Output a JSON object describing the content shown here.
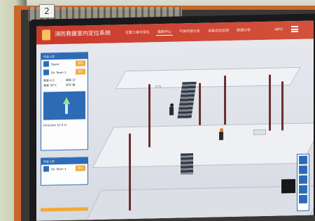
{
  "photo": {
    "placard_number": "2"
  },
  "app": {
    "title": "消防救援室内定位系统",
    "nav": [
      {
        "label": "位置三维可视化",
        "active": false
      },
      {
        "label": "指挥中心",
        "active": true
      },
      {
        "label": "气体传感分析",
        "active": false
      },
      {
        "label": "设备状态监测",
        "active": false
      },
      {
        "label": "数据分析",
        "active": false
      }
    ],
    "user": "INFO",
    "accent_color": "#c93a2c",
    "panel_color": "#2d6bb6"
  },
  "left_panel": {
    "card1": {
      "header": "作业人员",
      "rows": [
        {
          "name": "Spare",
          "sub": "信息",
          "button": "定位"
        },
        {
          "name": "Dir Team 1",
          "sub": "已登记",
          "button": "定位"
        }
      ],
      "stats": [
        "高度  4.5",
        "楼层  1F",
        "温度  30°C",
        "信号  强"
      ],
      "footer": "Direction 12.0 m"
    },
    "card2": {
      "header": "作业人员",
      "rows": [
        {
          "name": "Dir Team 2",
          "sub": "已登记",
          "button": "定位"
        }
      ]
    }
  },
  "scene": {
    "people_count": 3
  }
}
